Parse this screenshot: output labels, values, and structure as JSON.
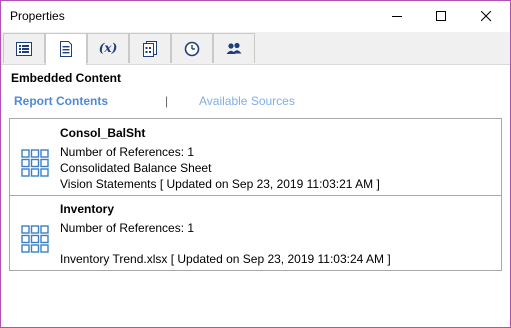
{
  "window": {
    "title": "Properties"
  },
  "tabs": [
    {
      "name": "list-view-icon",
      "active": false
    },
    {
      "name": "document-icon",
      "active": true
    },
    {
      "name": "formula-icon",
      "label": "(x)",
      "active": false
    },
    {
      "name": "report-pages-icon",
      "active": false
    },
    {
      "name": "clock-icon",
      "active": false
    },
    {
      "name": "users-icon",
      "active": false
    }
  ],
  "section": {
    "title": "Embedded Content"
  },
  "subnav": {
    "report": "Report Contents",
    "separator": "|",
    "sources": "Available Sources"
  },
  "items": [
    {
      "name": "Consol_BalSht",
      "references": "Number of References: 1",
      "description": "Consolidated Balance Sheet",
      "source": "Vision Statements [ Updated on Sep 23, 2019 11:03:21 AM ]"
    },
    {
      "name": "Inventory",
      "references": "Number of References: 1",
      "description": "",
      "source": "Inventory Trend.xlsx [ Updated on Sep 23, 2019 11:03:24 AM ]"
    }
  ],
  "colors": {
    "accent": "#4e8ad6",
    "icon_blue": "#1f3f7a",
    "grid_blue": "#3a7fc1",
    "border": "#b24fb5"
  }
}
